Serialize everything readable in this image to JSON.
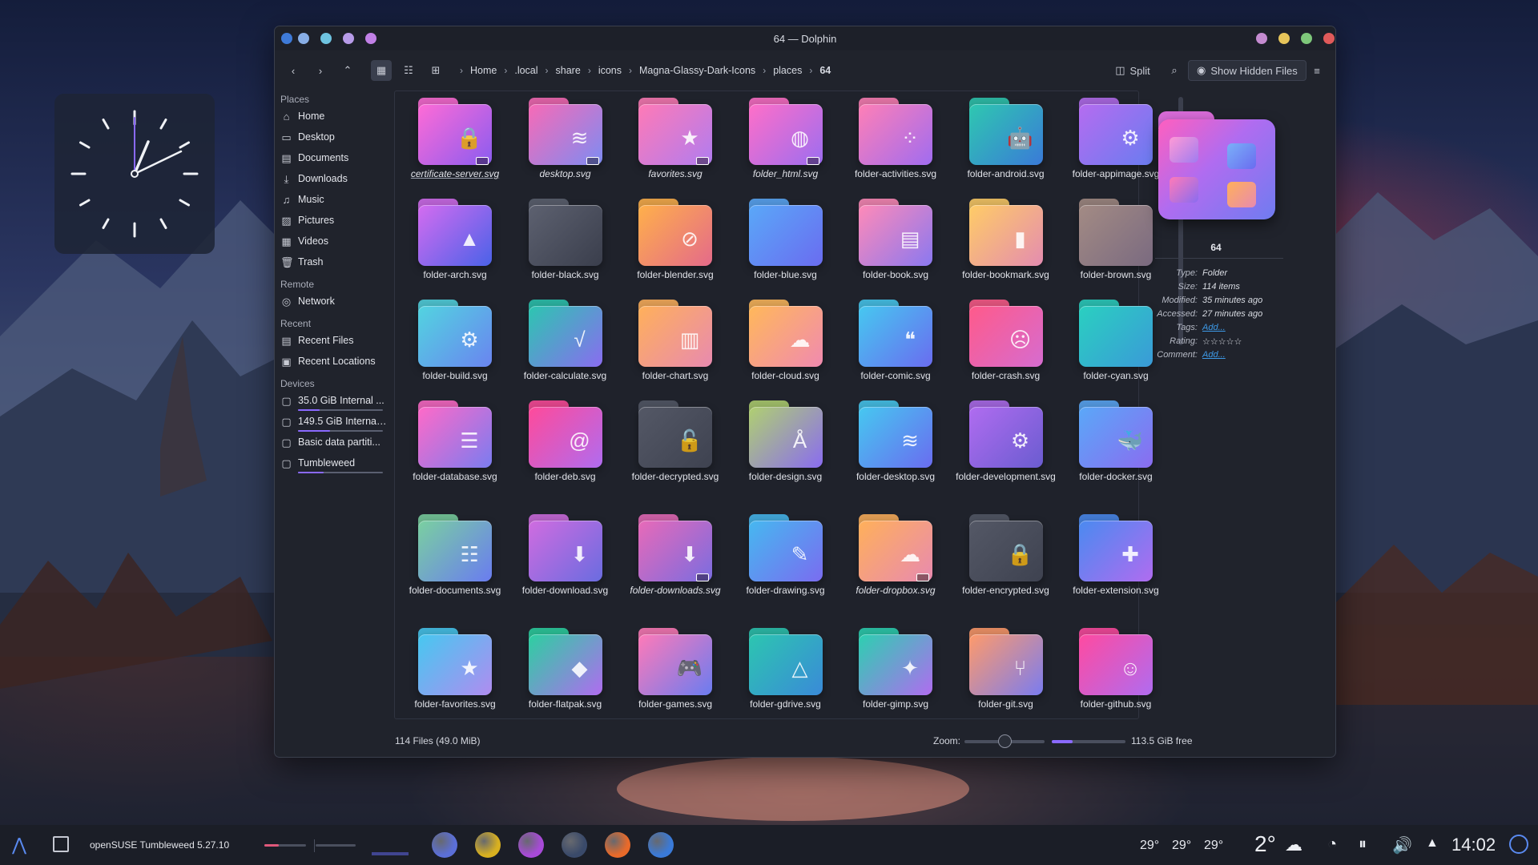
{
  "window": {
    "title": "64 — Dolphin",
    "left_dots": [
      "#88aee6",
      "#6ec3e0",
      "#b79be8",
      "#c180e6"
    ],
    "right_dots": [
      "#c48bd0",
      "#e6c45a",
      "#7ec77a",
      "#e05a5a"
    ]
  },
  "toolbar": {
    "breadcrumbs": [
      "Home",
      ".local",
      "share",
      "icons",
      "Magna-Glassy-Dark-Icons",
      "places",
      "64"
    ],
    "split_label": "Split",
    "hidden_label": "Show Hidden Files"
  },
  "sidebar": {
    "sections": [
      {
        "header": "Places",
        "items": [
          {
            "label": "Home",
            "icon": "home-icon",
            "glyph": "⌂"
          },
          {
            "label": "Desktop",
            "icon": "desktop-icon",
            "glyph": "▭"
          },
          {
            "label": "Documents",
            "icon": "documents-icon",
            "glyph": "▤"
          },
          {
            "label": "Downloads",
            "icon": "downloads-icon",
            "glyph": "⤓"
          },
          {
            "label": "Music",
            "icon": "music-icon",
            "glyph": "♫"
          },
          {
            "label": "Pictures",
            "icon": "pictures-icon",
            "glyph": "▨"
          },
          {
            "label": "Videos",
            "icon": "videos-icon",
            "glyph": "▦"
          },
          {
            "label": "Trash",
            "icon": "trash-icon",
            "glyph": "🗑"
          }
        ]
      },
      {
        "header": "Remote",
        "items": [
          {
            "label": "Network",
            "icon": "network-icon",
            "glyph": "◎"
          }
        ]
      },
      {
        "header": "Recent",
        "items": [
          {
            "label": "Recent Files",
            "icon": "recent-files-icon",
            "glyph": "▤"
          },
          {
            "label": "Recent Locations",
            "icon": "recent-locations-icon",
            "glyph": "▣"
          }
        ]
      },
      {
        "header": "Devices",
        "items": [
          {
            "label": "35.0 GiB Internal ...",
            "icon": "drive-icon",
            "glyph": "▢",
            "usage": 0.25
          },
          {
            "label": "149.5 GiB Internal ...",
            "icon": "drive-icon",
            "glyph": "▢",
            "usage": 0.38
          },
          {
            "label": "Basic data partiti...",
            "icon": "drive-icon",
            "glyph": "▢"
          },
          {
            "label": "Tumbleweed",
            "icon": "drive-icon",
            "glyph": "▢",
            "usage": 0.3
          }
        ]
      }
    ]
  },
  "files": [
    {
      "name": "certificate-server.svg",
      "colors": [
        "#ff6bd6",
        "#8a5cf0"
      ],
      "glyph": "🔒",
      "badge": true,
      "italic": true,
      "selected": true
    },
    {
      "name": "desktop.svg",
      "colors": [
        "#f86ab6",
        "#7d8cf2"
      ],
      "glyph": "≋",
      "badge": true,
      "italic": true
    },
    {
      "name": "favorites.svg",
      "colors": [
        "#ff7ab6",
        "#b07cf0"
      ],
      "glyph": "★",
      "badge": true,
      "italic": true
    },
    {
      "name": "folder_html.svg",
      "colors": [
        "#ff6fc8",
        "#9c6df0"
      ],
      "glyph": "◍",
      "badge": true,
      "italic": true
    },
    {
      "name": "folder-activities.svg",
      "colors": [
        "#ff7fb6",
        "#a06cf0"
      ],
      "glyph": "⁘"
    },
    {
      "name": "folder-android.svg",
      "colors": [
        "#2ec8b0",
        "#3a7ad8"
      ],
      "glyph": "🤖"
    },
    {
      "name": "folder-appimage.svg",
      "colors": [
        "#b56cf0",
        "#6a7cf0"
      ],
      "glyph": "⚙"
    },
    {
      "name": "folder-arch.svg",
      "colors": [
        "#d46cf0",
        "#4a62e8"
      ],
      "glyph": "▲"
    },
    {
      "name": "folder-black.svg",
      "colors": [
        "#5d6170",
        "#3a3e4c"
      ],
      "glyph": ""
    },
    {
      "name": "folder-blender.svg",
      "colors": [
        "#ffb04a",
        "#e46a8a"
      ],
      "glyph": "⊘"
    },
    {
      "name": "folder-blue.svg",
      "colors": [
        "#5aa8f8",
        "#6a6cf0"
      ],
      "glyph": ""
    },
    {
      "name": "folder-book.svg",
      "colors": [
        "#ff8ab8",
        "#8a78f0"
      ],
      "glyph": "▤"
    },
    {
      "name": "folder-bookmark.svg",
      "colors": [
        "#ffcc66",
        "#e48cb0"
      ],
      "glyph": "▮"
    },
    {
      "name": "folder-brown.svg",
      "colors": [
        "#a38b84",
        "#7a6a80"
      ],
      "glyph": ""
    },
    {
      "name": "folder-build.svg",
      "colors": [
        "#52d4e0",
        "#6a84f0"
      ],
      "glyph": "⚙"
    },
    {
      "name": "folder-calculate.svg",
      "colors": [
        "#2cc6b0",
        "#8a6cf0"
      ],
      "glyph": "√"
    },
    {
      "name": "folder-chart.svg",
      "colors": [
        "#ffb05a",
        "#e88ab0"
      ],
      "glyph": "▥"
    },
    {
      "name": "folder-cloud.svg",
      "colors": [
        "#ffb85a",
        "#f08ab0"
      ],
      "glyph": "☁"
    },
    {
      "name": "folder-comic.svg",
      "colors": [
        "#46c8f0",
        "#6a6cf0"
      ],
      "glyph": "❝"
    },
    {
      "name": "folder-crash.svg",
      "colors": [
        "#ff5a8a",
        "#d66cd0"
      ],
      "glyph": "☹"
    },
    {
      "name": "folder-cyan.svg",
      "colors": [
        "#2ad0c0",
        "#3a9ad8"
      ],
      "glyph": ""
    },
    {
      "name": "folder-database.svg",
      "colors": [
        "#ff6ac8",
        "#7a7cf0"
      ],
      "glyph": "☰"
    },
    {
      "name": "folder-deb.svg",
      "colors": [
        "#ff4a9a",
        "#b06cf0"
      ],
      "glyph": "@"
    },
    {
      "name": "folder-decrypted.svg",
      "colors": [
        "#545866",
        "#3e4250"
      ],
      "glyph": "🔓"
    },
    {
      "name": "folder-design.svg",
      "colors": [
        "#b0d070",
        "#8a6cf0"
      ],
      "glyph": "Å"
    },
    {
      "name": "folder-desktop.svg",
      "colors": [
        "#46c8f0",
        "#6a6cf0"
      ],
      "glyph": "≋"
    },
    {
      "name": "folder-development.svg",
      "colors": [
        "#b06cf0",
        "#6a5cd0"
      ],
      "glyph": "⚙"
    },
    {
      "name": "folder-docker.svg",
      "colors": [
        "#5aa8f8",
        "#8a6cf0"
      ],
      "glyph": "🐳"
    },
    {
      "name": "folder-documents.svg",
      "colors": [
        "#7ad0a0",
        "#6a7cf0"
      ],
      "glyph": "☷"
    },
    {
      "name": "folder-download.svg",
      "colors": [
        "#d06ce0",
        "#6a6ce0"
      ],
      "glyph": "⬇"
    },
    {
      "name": "folder-downloads.svg",
      "colors": [
        "#e86ab8",
        "#7a6ce0"
      ],
      "glyph": "⬇",
      "badge": true,
      "italic": true
    },
    {
      "name": "folder-drawing.svg",
      "colors": [
        "#46b8f0",
        "#7a6cf0"
      ],
      "glyph": "✎"
    },
    {
      "name": "folder-dropbox.svg",
      "colors": [
        "#ffb05a",
        "#e88ab0"
      ],
      "glyph": "☁",
      "badge": true,
      "italic": true
    },
    {
      "name": "folder-encrypted.svg",
      "colors": [
        "#545866",
        "#3e4250"
      ],
      "glyph": "🔒"
    },
    {
      "name": "folder-extension.svg",
      "colors": [
        "#4a8af0",
        "#b06cf0"
      ],
      "glyph": "✚"
    },
    {
      "name": "folder-favorites.svg",
      "colors": [
        "#46c8f0",
        "#b08cf0"
      ],
      "glyph": "★"
    },
    {
      "name": "folder-flatpak.svg",
      "colors": [
        "#2cd0a0",
        "#b06cf0"
      ],
      "glyph": "◆"
    },
    {
      "name": "folder-games.svg",
      "colors": [
        "#ff7ab8",
        "#6a7cf0"
      ],
      "glyph": "🎮"
    },
    {
      "name": "folder-gdrive.svg",
      "colors": [
        "#2cc6b0",
        "#3a8ad8"
      ],
      "glyph": "△"
    },
    {
      "name": "folder-gimp.svg",
      "colors": [
        "#2cd0b0",
        "#b06cf0"
      ],
      "glyph": "✦"
    },
    {
      "name": "folder-git.svg",
      "colors": [
        "#ff9a6a",
        "#7a7cf0"
      ],
      "glyph": "⑂"
    },
    {
      "name": "folder-github.svg",
      "colors": [
        "#ff4aa0",
        "#b06cf0"
      ],
      "glyph": "☺"
    }
  ],
  "info": {
    "title": "64",
    "meta": [
      {
        "k": "Type:",
        "v": "Folder"
      },
      {
        "k": "Size:",
        "v": "114 items"
      },
      {
        "k": "Modified:",
        "v": "35 minutes ago"
      },
      {
        "k": "Accessed:",
        "v": "27 minutes ago"
      },
      {
        "k": "Tags:",
        "v": "Add...",
        "link": true
      },
      {
        "k": "Rating:",
        "v": "☆☆☆☆☆"
      },
      {
        "k": "Comment:",
        "v": "Add...",
        "link": true
      }
    ]
  },
  "status": {
    "summary": "114 Files (49.0 MiB)",
    "zoom_label": "Zoom:",
    "zoom_level": 0.5,
    "disk_used": 0.28,
    "free": "113.5 GiB free"
  },
  "taskbar": {
    "os_label": "openSUSE Tumbleweed 5.27.10",
    "temps": [
      "29°",
      "29°",
      "29°"
    ],
    "weather": "2°",
    "time": "14:02",
    "apps": [
      {
        "name": "app-icon-1",
        "color": "#5b6fd8"
      },
      {
        "name": "app-icon-2",
        "color": "#d8b020"
      },
      {
        "name": "shop-icon",
        "color": "#a84ad8"
      },
      {
        "name": "settings-app-icon",
        "color": "#3a4a6a"
      },
      {
        "name": "firefox-icon",
        "color": "#e86a2a"
      },
      {
        "name": "dolphin-icon",
        "color": "#3a7ad8"
      }
    ]
  },
  "colors": {
    "accent": "#8a69ff",
    "link": "#3d9ae8"
  }
}
